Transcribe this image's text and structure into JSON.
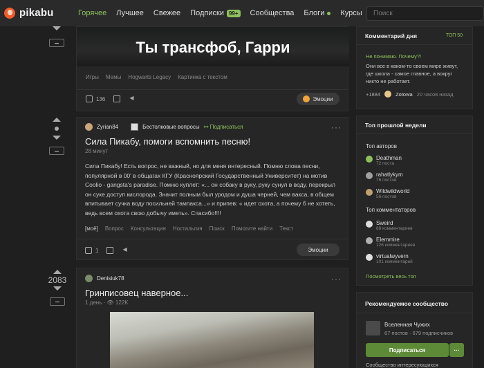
{
  "header": {
    "logo": "pikabu",
    "nav": [
      {
        "label": "Горячее",
        "active": true
      },
      {
        "label": "Лучшее"
      },
      {
        "label": "Свежее"
      },
      {
        "label": "Подписки",
        "badge": "99+"
      },
      {
        "label": "Сообщества"
      },
      {
        "label": "Блоги",
        "dot": true
      },
      {
        "label": "Курсы"
      }
    ],
    "search_placeholder": "Поиск"
  },
  "post1": {
    "image_text": "Ты трансфоб, Гарри",
    "tags": [
      "Игры",
      "Мемы",
      "Hogwarts Legacy",
      "Картинка с текстом"
    ],
    "comments": "136",
    "emotions_label": "Эмоции"
  },
  "post2": {
    "author": "Zyrian84",
    "community": "Бестолковые вопросы",
    "subscribe": "Подписаться",
    "more": "···",
    "title": "Сила Пикабу, помоги вспомнить песню!",
    "time": "28 минут",
    "body": "Сила Пикабу! Есть вопрос, не важный, но для меня интересный. Помню слова песни, популярной в 00' в общагах КГУ (Красноярский Государственный Университет) на мотив Coolio - gangsta's paradise. Помню куплет: «... он собаку в руку, руку сунул в воду, перекрыл он суке доступ кислорода. Значит полным был уродом и душа черней, чем вакса, в общем впитывает сучка воду посильней тампакса...» и припев: « идет охота, а почему б не хотеть, ведь всем охота свою добычу иметь». Спасибо!!!!",
    "tags": [
      "[моё]",
      "Вопрос",
      "Консультация",
      "Ностальгия",
      "Поиск",
      "Помогите найти",
      "Текст"
    ],
    "comments": "1",
    "emotions_label": "Эмоции"
  },
  "post3": {
    "rating": "2083",
    "author": "Denisiuk78",
    "more": "···",
    "title": "Гринписовец наверное...",
    "meta": "1 день · 👁 122K"
  },
  "sidebar": {
    "comment_day": {
      "title": "Комментарий дня",
      "top": "ТОП 50",
      "question": "Не понимаю. Почему?!",
      "text": "Они все в каком-то своем мире живут, где школа - самое главное, а вокруг никто не работает.",
      "rating": "+1884",
      "user": "Zotowa",
      "time": "20 часов назад"
    },
    "top_week": {
      "title": "Топ прошлой недели",
      "authors_title": "Топ авторов",
      "authors": [
        {
          "name": "Deathman",
          "sub": "72 поста",
          "color": "#8dc05c"
        },
        {
          "name": "rahatlykym",
          "sub": "76 постов",
          "color": "#a0a0a0"
        },
        {
          "name": "Wildwildworld",
          "sub": "56 постов",
          "color": "#c0a070"
        }
      ],
      "commenters_title": "Топ комментаторов",
      "commenters": [
        {
          "name": "Sweird",
          "sub": "88 комментариев",
          "color": "#ddd"
        },
        {
          "name": "Elemmire",
          "sub": "126 комментариев",
          "color": "#b0b0b0"
        },
        {
          "name": "virtualwyvern",
          "sub": "101 комментарий",
          "color": "#e0e0e0"
        }
      ],
      "view_all": "Посмотреть весь топ"
    },
    "recommended": {
      "title": "Рекомендуемое сообщество",
      "name": "Вселенная Чужих",
      "stats": "67 постов · 679 подписчиков",
      "subscribe": "Подписаться",
      "more": "···",
      "footer": "Сообщество интересующихся"
    }
  }
}
